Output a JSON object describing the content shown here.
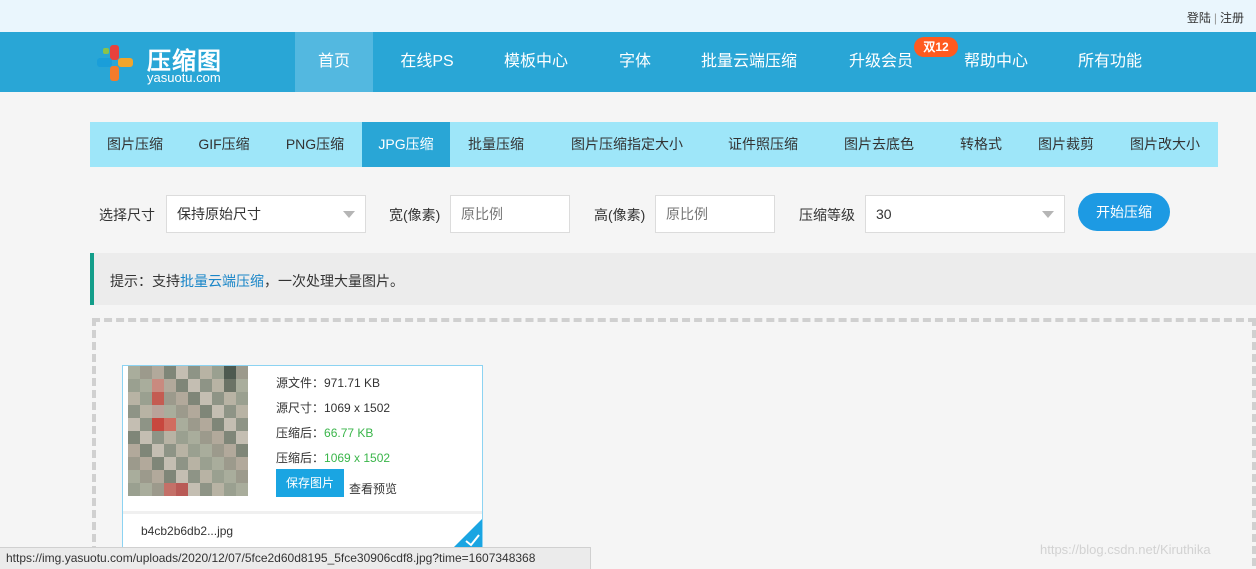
{
  "topbar": {
    "login": "登陆",
    "separator": "|",
    "register": "注册"
  },
  "logo": {
    "name": "压缩图",
    "domain": "yasuotu.com",
    "icon": "cross-logo-icon"
  },
  "nav": {
    "items": [
      "首页",
      "在线PS",
      "模板中心",
      "字体",
      "批量云端压缩",
      "升级会员",
      "帮助中心",
      "所有功能"
    ],
    "active": "首页",
    "badge": "双12"
  },
  "subnav": {
    "items": [
      "图片压缩",
      "GIF压缩",
      "PNG压缩",
      "JPG压缩",
      "批量压缩",
      "图片压缩指定大小",
      "证件照压缩",
      "图片去底色",
      "转格式",
      "图片裁剪",
      "图片改大小"
    ],
    "active": "JPG压缩"
  },
  "form": {
    "size_label": "选择尺寸",
    "size_value": "保持原始尺寸",
    "width_label": "宽(像素)",
    "width_placeholder": "原比例",
    "height_label": "高(像素)",
    "height_placeholder": "原比例",
    "level_label": "压缩等级",
    "level_value": "30",
    "start_button": "开始压缩"
  },
  "tip": {
    "prefix": "提示：支持",
    "link": "批量云端压缩",
    "suffix": "，一次处理大量图片。"
  },
  "card": {
    "source_file": "源文件：971.71 KB",
    "source_size": "源尺寸：1069 x 1502",
    "after_label_1": "压缩后：",
    "after_value_1": "66.77 KB",
    "after_label_2": "压缩后：",
    "after_value_2": "1069 x 1502",
    "save_button": "保存图片",
    "preview_link": "查看预览",
    "filename": "b4cb2b6db2...jpg"
  },
  "statusbar": {
    "url": "https://img.yasuotu.com/uploads/2020/12/07/5fce2d60d8195_5fce30906cdf8.jpg?time=1607348368"
  },
  "watermark": "https://blog.csdn.net/Kiruthika",
  "colors": {
    "nav": "#29a6d6",
    "subnav": "#9ee6f9",
    "accent": "#1d9ae3",
    "badge": "#ff5a1f",
    "success": "#3ab54a"
  }
}
